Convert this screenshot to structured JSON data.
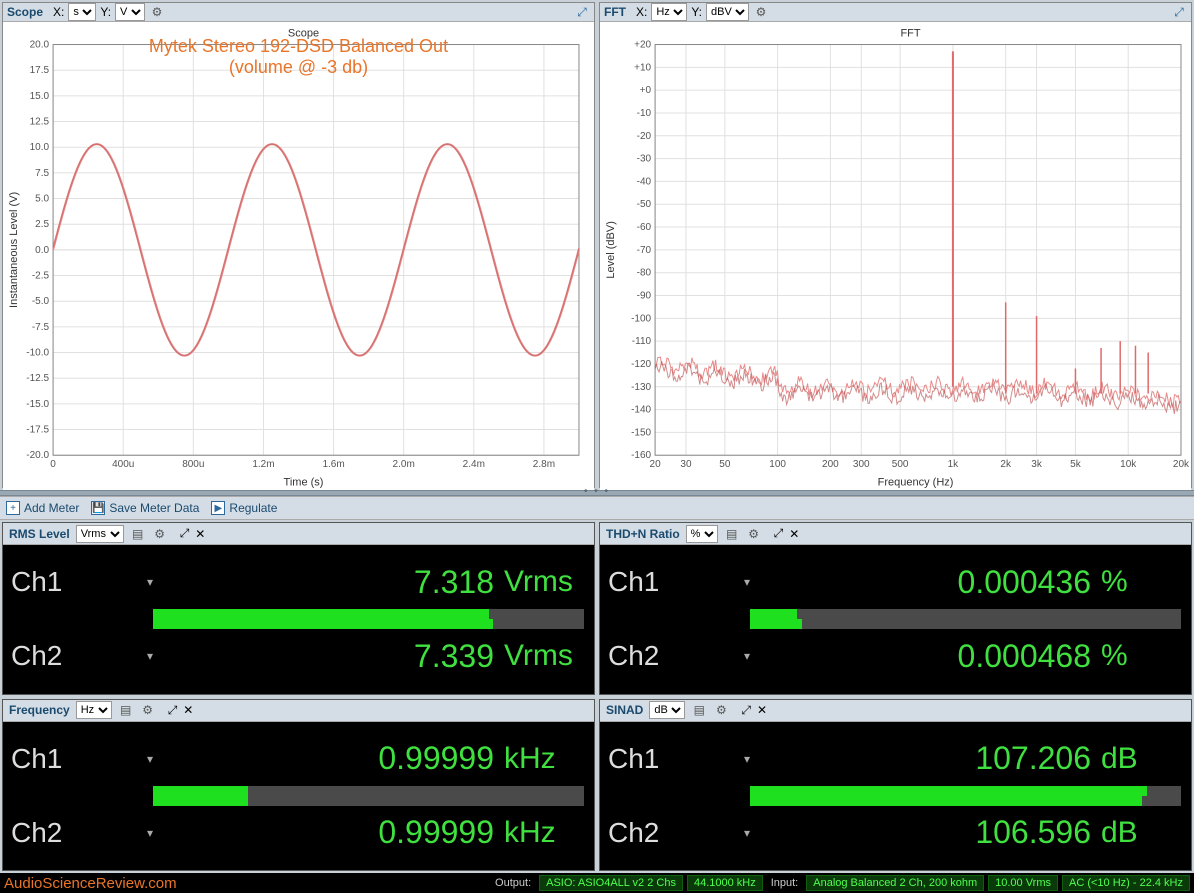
{
  "scope_panel": {
    "title": "Scope",
    "x_label": "X:",
    "x_unit": "s",
    "y_label": "Y:",
    "y_unit": "V",
    "chart_title": "Scope",
    "xaxis": "Time (s)",
    "yaxis": "Instantaneous Level (V)",
    "annotation_line1": "Mytek Stereo 192-DSD Balanced Out",
    "annotation_line2": "(volume @ -3 db)"
  },
  "fft_panel": {
    "title": "FFT",
    "x_label": "X:",
    "x_unit": "Hz",
    "y_label": "Y:",
    "y_unit": "dBV",
    "chart_title": "FFT",
    "xaxis": "Frequency (Hz)",
    "yaxis": "Level (dBV)"
  },
  "toolbar": {
    "add_meter": "Add Meter",
    "save_meter": "Save Meter Data",
    "regulate": "Regulate"
  },
  "meters": {
    "rms": {
      "title": "RMS Level",
      "unit_sel": "Vrms",
      "ch1": "Ch1",
      "ch2": "Ch2",
      "v1": "7.318",
      "u1": "Vrms",
      "v2": "7.339",
      "u2": "Vrms",
      "bar1": 78,
      "bar2": 79
    },
    "thdn": {
      "title": "THD+N Ratio",
      "unit_sel": "%",
      "ch1": "Ch1",
      "ch2": "Ch2",
      "v1": "0.000436",
      "u1": "%",
      "v2": "0.000468",
      "u2": "%",
      "bar1": 11,
      "bar2": 12
    },
    "freq": {
      "title": "Frequency",
      "unit_sel": "Hz",
      "ch1": "Ch1",
      "ch2": "Ch2",
      "v1": "0.99999",
      "u1": "kHz",
      "v2": "0.99999",
      "u2": "kHz",
      "bar1": 22,
      "bar2": 22
    },
    "sinad": {
      "title": "SINAD",
      "unit_sel": "dB",
      "ch1": "Ch1",
      "ch2": "Ch2",
      "v1": "107.206",
      "u1": "dB",
      "v2": "106.596",
      "u2": "dB",
      "bar1": 92,
      "bar2": 91
    }
  },
  "status": {
    "brand": "AudioScienceReview.com",
    "output_lbl": "Output:",
    "output1": "ASIO: ASIO4ALL v2 2 Chs",
    "output2": "44.1000 kHz",
    "input_lbl": "Input:",
    "input1": "Analog Balanced 2 Ch, 200 kohm",
    "input2": "10.00 Vrms",
    "input3": "AC (<10 Hz) - 22.4 kHz"
  },
  "chart_data": [
    {
      "type": "line",
      "title": "Scope",
      "xlabel": "Time (s)",
      "ylabel": "Instantaneous Level (V)",
      "x_ticks": [
        "0",
        "400u",
        "800u",
        "1.2m",
        "1.6m",
        "2.0m",
        "2.4m",
        "2.8m"
      ],
      "y_ticks": [
        -20,
        -17.5,
        -15,
        -12.5,
        -10,
        -7.5,
        -5,
        -2.5,
        0,
        2.5,
        5,
        7.5,
        10,
        12.5,
        15,
        17.5,
        20
      ],
      "xlim": [
        0,
        0.003
      ],
      "ylim": [
        -20.0,
        20.0
      ],
      "series": [
        {
          "name": "Ch1",
          "description": "1 kHz sine, amplitude ≈ 10.3 V",
          "amplitude": 10.3,
          "frequency_hz": 1000
        },
        {
          "name": "Ch2",
          "description": "1 kHz sine, amplitude ≈ 10.3 V",
          "amplitude": 10.3,
          "frequency_hz": 1000
        }
      ]
    },
    {
      "type": "line",
      "title": "FFT",
      "xlabel": "Frequency (Hz)",
      "ylabel": "Level (dBV)",
      "x_ticks": [
        20,
        30,
        50,
        100,
        200,
        300,
        500,
        "1k",
        "2k",
        "3k",
        "5k",
        "10k",
        "20k"
      ],
      "y_ticks": [
        -160,
        -150,
        -140,
        -130,
        -120,
        -110,
        -100,
        -90,
        -80,
        -70,
        -60,
        -50,
        -40,
        -30,
        -20,
        -10,
        0,
        10,
        20
      ],
      "xlim_hz": [
        20,
        20000
      ],
      "ylim": [
        -160,
        20
      ],
      "x_scale": "log",
      "noise_floor_dBV_approx": -130,
      "fundamental": {
        "freq_hz": 1000,
        "level_dBV": 17
      },
      "harmonics_approx": [
        {
          "freq_hz": 2000,
          "level_dBV": -93
        },
        {
          "freq_hz": 3000,
          "level_dBV": -99
        },
        {
          "freq_hz": 5000,
          "level_dBV": -122
        },
        {
          "freq_hz": 7000,
          "level_dBV": -113
        },
        {
          "freq_hz": 9000,
          "level_dBV": -110
        },
        {
          "freq_hz": 11000,
          "level_dBV": -112
        },
        {
          "freq_hz": 13000,
          "level_dBV": -115
        }
      ]
    }
  ]
}
